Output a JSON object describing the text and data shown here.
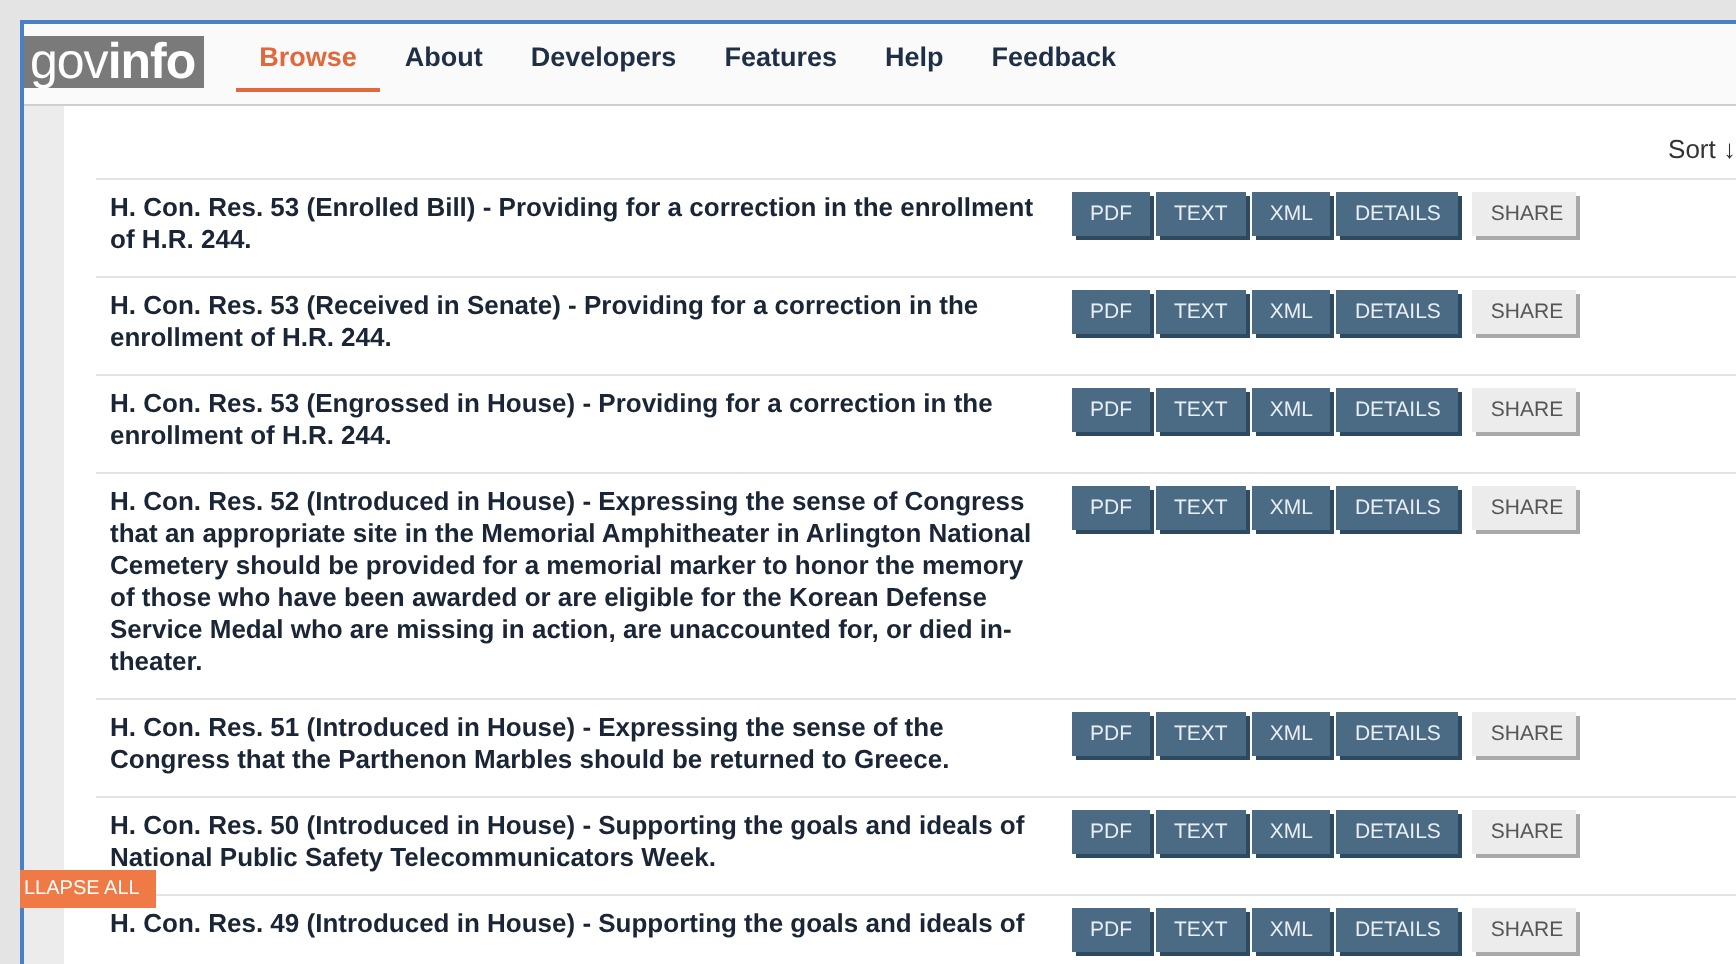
{
  "header": {
    "logo": {
      "light": "gov",
      "bold": "info"
    },
    "nav": [
      {
        "label": "Browse",
        "selected": true
      },
      {
        "label": "About",
        "selected": false
      },
      {
        "label": "Developers",
        "selected": false
      },
      {
        "label": "Features",
        "selected": false
      },
      {
        "label": "Help",
        "selected": false
      },
      {
        "label": "Feedback",
        "selected": false
      }
    ]
  },
  "sort": {
    "label": "Sort ↓"
  },
  "results": [
    {
      "title": "H. Con. Res. 53 (Enrolled Bill) - Providing for a correction in the enrollment of H.R. 244.",
      "actions": [
        "PDF",
        "TEXT",
        "XML",
        "DETAILS",
        "SHARE"
      ]
    },
    {
      "title": "H. Con. Res. 53 (Received in Senate) - Providing for a correction in the enrollment of H.R. 244.",
      "actions": [
        "PDF",
        "TEXT",
        "XML",
        "DETAILS",
        "SHARE"
      ]
    },
    {
      "title": "H. Con. Res. 53 (Engrossed in House) - Providing for a correction in the enrollment of H.R. 244.",
      "actions": [
        "PDF",
        "TEXT",
        "XML",
        "DETAILS",
        "SHARE"
      ]
    },
    {
      "title": "H. Con. Res. 52 (Introduced in House) - Expressing the sense of Congress that an appropriate site in the Memorial Amphitheater in Arlington National Cemetery should be provided for a memorial marker to honor the memory of those who have been awarded or are eligible for the Korean Defense Service Medal who are missing in action, are unaccounted for, or died in-theater.",
      "actions": [
        "PDF",
        "TEXT",
        "XML",
        "DETAILS",
        "SHARE"
      ]
    },
    {
      "title": "H. Con. Res. 51 (Introduced in House) - Expressing the sense of the Congress that the Parthenon Marbles should be returned to Greece.",
      "actions": [
        "PDF",
        "TEXT",
        "XML",
        "DETAILS",
        "SHARE"
      ]
    },
    {
      "title": "H. Con. Res. 50 (Introduced in House) - Supporting the goals and ideals of National Public Safety Telecommunicators Week.",
      "actions": [
        "PDF",
        "TEXT",
        "XML",
        "DETAILS",
        "SHARE"
      ]
    },
    {
      "title": "H. Con. Res. 49 (Introduced in House) - Supporting the goals and ideals of",
      "actions": [
        "PDF",
        "TEXT",
        "XML",
        "DETAILS",
        "SHARE"
      ]
    }
  ],
  "collapse_button": {
    "label": "LLAPSE ALL"
  }
}
